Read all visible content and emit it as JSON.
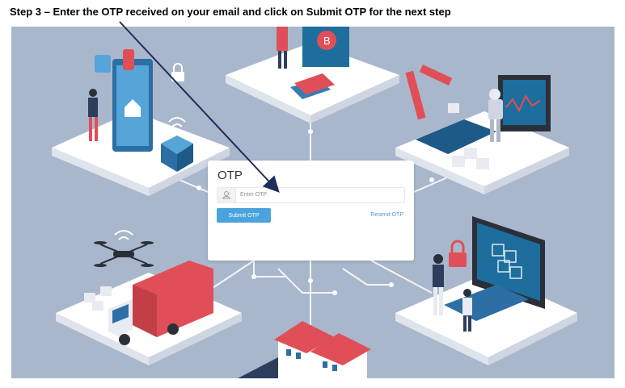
{
  "instruction": "Step 3 – Enter the OTP received on your email and click on Submit OTP for the next step",
  "otp_form": {
    "title": "OTP",
    "input_placeholder": "Enter OTP",
    "input_value": "",
    "submit_label": "Submit OTP",
    "resend_label": "Resend OTP"
  },
  "colors": {
    "background": "#a9b7cc",
    "button": "#4aa3dc",
    "link": "#4a9ad4",
    "arrow": "#1f2d5a",
    "truck_red": "#e04f57",
    "panel_blue": "#1d6e9c"
  },
  "icons": [
    "user-icon",
    "arrow-pointer",
    "bitcoin-icon",
    "lock-icon",
    "wifi-icon",
    "drone-icon"
  ]
}
